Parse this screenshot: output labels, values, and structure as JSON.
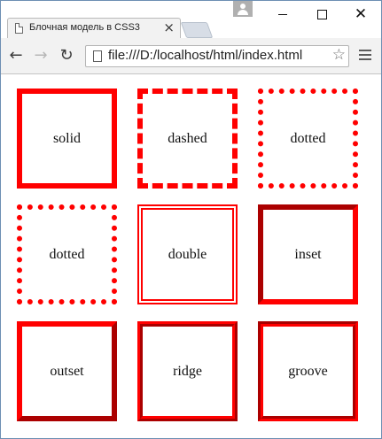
{
  "tab": {
    "title": "Блочная модель в CSS3",
    "close": "×"
  },
  "window_controls": {
    "close_glyph": "✕"
  },
  "toolbar": {
    "back": "←",
    "forward": "→",
    "reload": "↻",
    "url": "file:///D:/localhost/html/index.html",
    "star": "☆"
  },
  "boxes": [
    {
      "label": "solid",
      "border_style": "solid"
    },
    {
      "label": "dashed",
      "border_style": "dashed"
    },
    {
      "label": "dotted",
      "border_style": "dotted"
    },
    {
      "label": "dotted",
      "border_style": "dotted"
    },
    {
      "label": "double",
      "border_style": "double"
    },
    {
      "label": "inset",
      "border_style": "inset"
    },
    {
      "label": "outset",
      "border_style": "outset"
    },
    {
      "label": "ridge",
      "border_style": "ridge"
    },
    {
      "label": "groove",
      "border_style": "groove"
    }
  ],
  "colors": {
    "border": "#ff0000",
    "window_frame": "#6d8fb3"
  }
}
